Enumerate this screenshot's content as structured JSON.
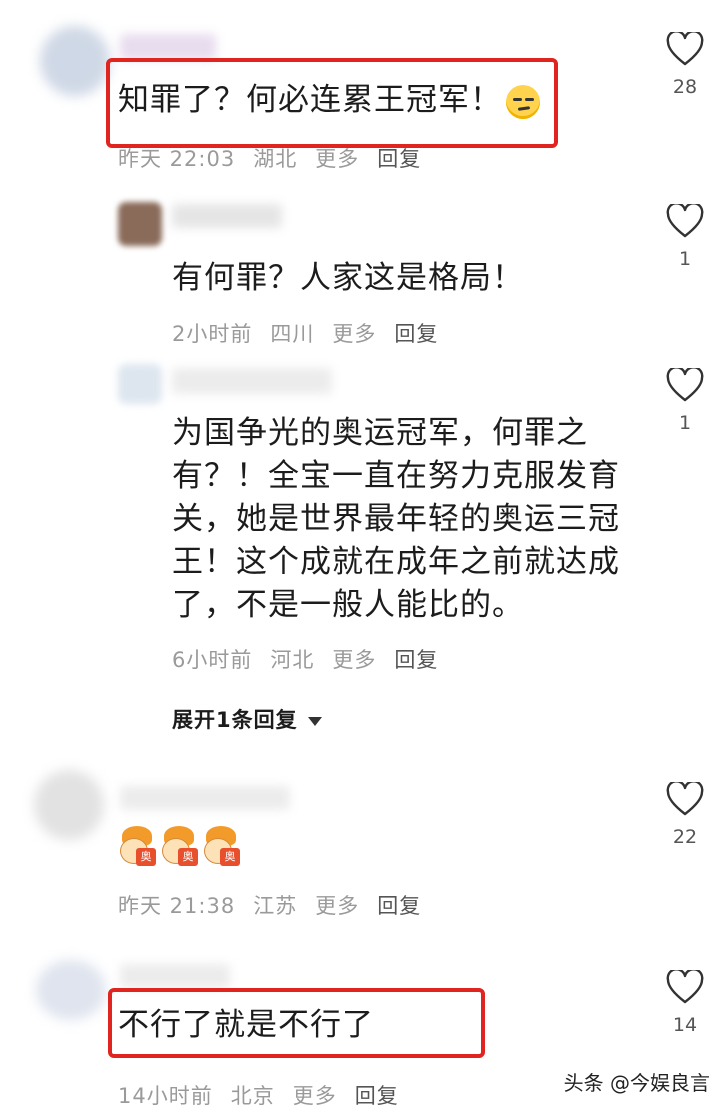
{
  "comments": [
    {
      "text": "知罪了？何必连累王冠军！",
      "meta": {
        "time": "昨天 22:03",
        "location": "湖北",
        "more": "更多",
        "reply": "回复"
      },
      "likes": "28",
      "emoji": "smirk-face"
    },
    {
      "text": "有何罪？人家这是格局！",
      "meta": {
        "time": "2小时前",
        "location": "四川",
        "more": "更多",
        "reply": "回复"
      },
      "likes": "1"
    },
    {
      "text": "为国争光的奥运冠军，何罪之有？！全宝一直在努力克服发育关，她是世界最年轻的奥运三冠王！这个成就在成年之前就达成了，不是一般人能比的。",
      "meta": {
        "time": "6小时前",
        "location": "河北",
        "more": "更多",
        "reply": "回复"
      },
      "likes": "1"
    },
    {
      "text": "",
      "meta": {
        "time": "昨天 21:38",
        "location": "江苏",
        "more": "更多",
        "reply": "回复"
      },
      "likes": "22",
      "stickers": [
        "奥",
        "奥",
        "奥"
      ]
    },
    {
      "text": "不行了就是不行了",
      "meta": {
        "time": "14小时前",
        "location": "北京",
        "more": "更多",
        "reply": "回复"
      },
      "likes": "14"
    }
  ],
  "expand_replies": "展开1条回复",
  "watermark": "头条 @今娱良言",
  "colors": {
    "highlight_box": "#e0241f",
    "meta_text": "#9a9a9a"
  }
}
